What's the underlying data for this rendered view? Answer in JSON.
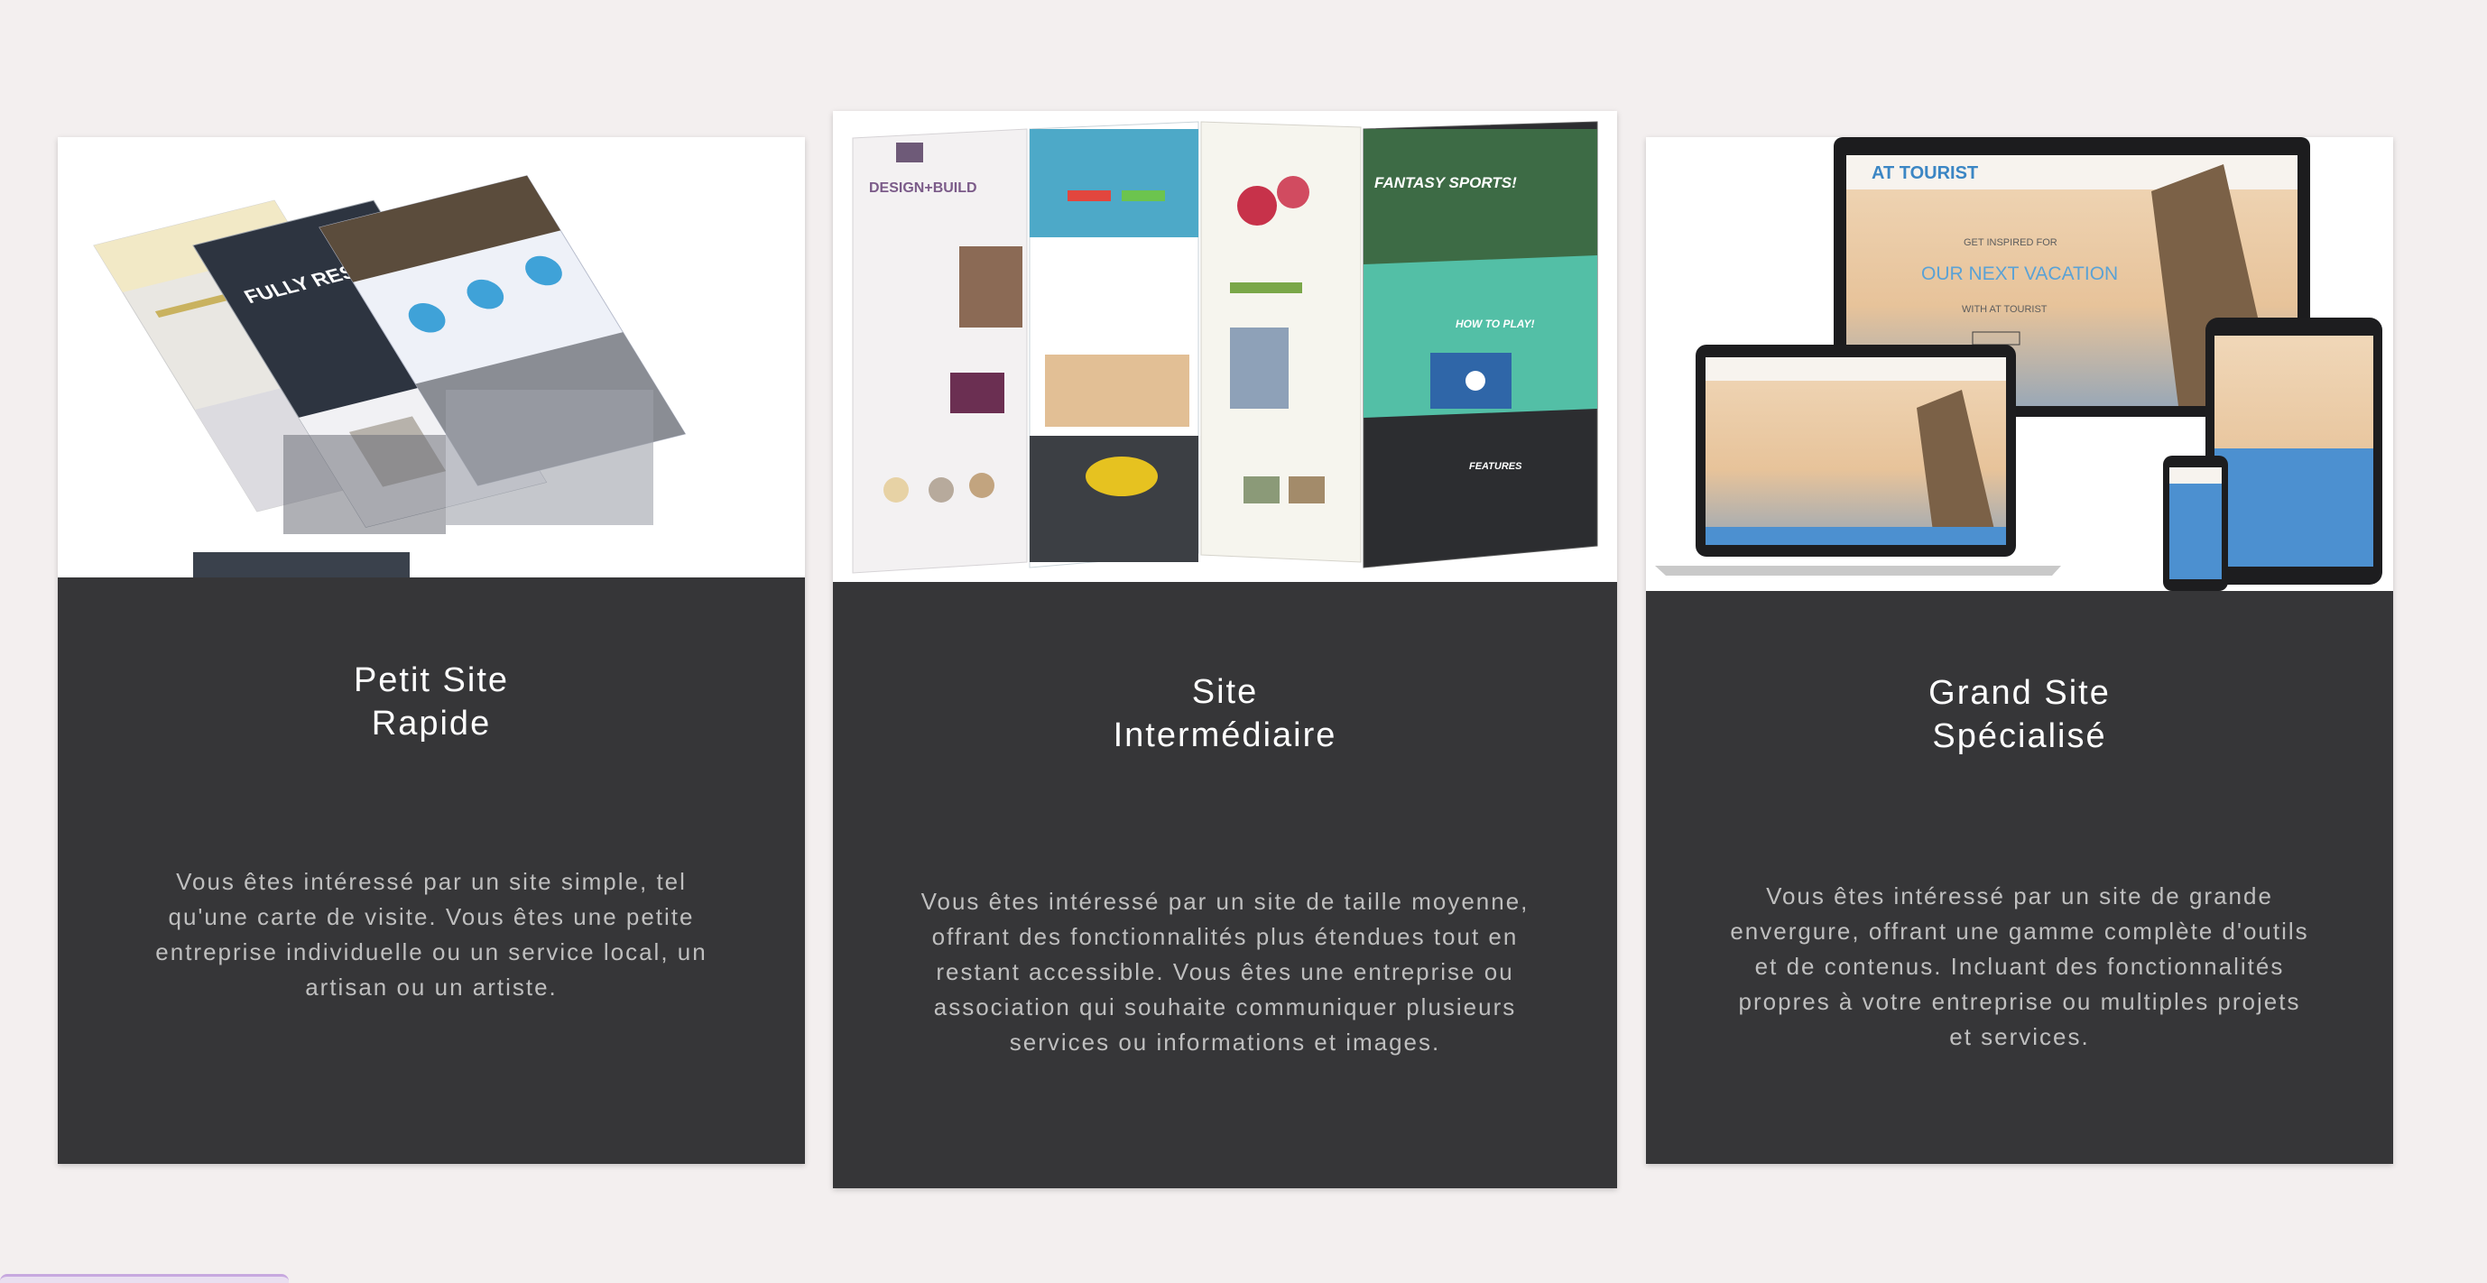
{
  "cards": [
    {
      "title_line1": "Petit Site",
      "title_line2": "Rapide",
      "description": "Vous êtes intéressé par un site simple, tel qu'une carte de visite. Vous êtes une petite entreprise individuelle ou un service local, un artisan ou un artiste."
    },
    {
      "title_line1": "Site",
      "title_line2": "Intermédiaire",
      "description": "Vous êtes intéressé par un site de taille moyenne, offrant des fonctionnalités plus étendues tout en restant accessible. Vous êtes une entreprise ou association qui souhaite communiquer plusieurs services ou informations et images."
    },
    {
      "title_line1": "Grand Site",
      "title_line2": "Spécialisé",
      "description": "Vous êtes intéressé par un site de grande envergure, offrant une gamme complète d'outils et de contenus. Incluant des fonctionnalités propres à votre entreprise ou multiples projets et services."
    }
  ],
  "mockup_text": {
    "card1_headline": "FULLY RESPONSIVE",
    "card2_brand": "DESIGN+BUILD",
    "card2_sports": "FANTASY SPORTS!",
    "card2_howto": "HOW TO PLAY!",
    "card2_features": "FEATURES",
    "card3_brand": "AT TOURIST",
    "card3_tagline": "GET INSPIRED FOR",
    "card3_headline": "OUR NEXT VACATION",
    "card3_sub": "WITH AT TOURIST"
  },
  "colors": {
    "page_bg": "#f3efef",
    "card_bg": "#363638",
    "title": "#ffffff",
    "description": "#bfbfbf"
  }
}
